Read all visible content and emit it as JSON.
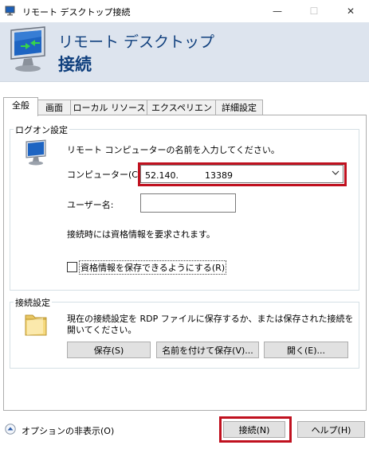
{
  "window": {
    "title": "リモート デスクトップ接続",
    "minimize": "—",
    "maximize": "☐",
    "close": "✕"
  },
  "banner": {
    "line1": "リモート デスクトップ",
    "line2": "接続"
  },
  "tabs": [
    {
      "label": "全般",
      "active": true
    },
    {
      "label": "画面"
    },
    {
      "label": "ローカル リソース"
    },
    {
      "label": "エクスペリエンス"
    },
    {
      "label": "詳細設定"
    }
  ],
  "logon": {
    "group_label": "ログオン設定",
    "instruction": "リモート コンピューターの名前を入力してください。",
    "computer_label": "コンピューター(C):",
    "computer_value": "52.140.　　　13389",
    "username_label": "ユーザー名:",
    "username_value": "",
    "credential_note": "接続時には資格情報を要求されます。",
    "save_credentials_label": "資格情報を保存できるようにする(R)",
    "save_credentials_checked": false
  },
  "connection": {
    "group_label": "接続設定",
    "description_line1": "現在の接続設定を RDP ファイルに保存するか、または保存された接続を",
    "description_line2": "開いてください。",
    "save_button": "保存(S)",
    "save_as_button": "名前を付けて保存(V)...",
    "open_button": "開く(E)..."
  },
  "footer": {
    "options_label": "オプションの非表示(O)",
    "connect_button": "接続(N)",
    "help_button": "ヘルプ(H)"
  },
  "colors": {
    "highlight": "#c0111f",
    "banner_bg": "#dde4ee",
    "banner_text": "#0f3f7d"
  }
}
